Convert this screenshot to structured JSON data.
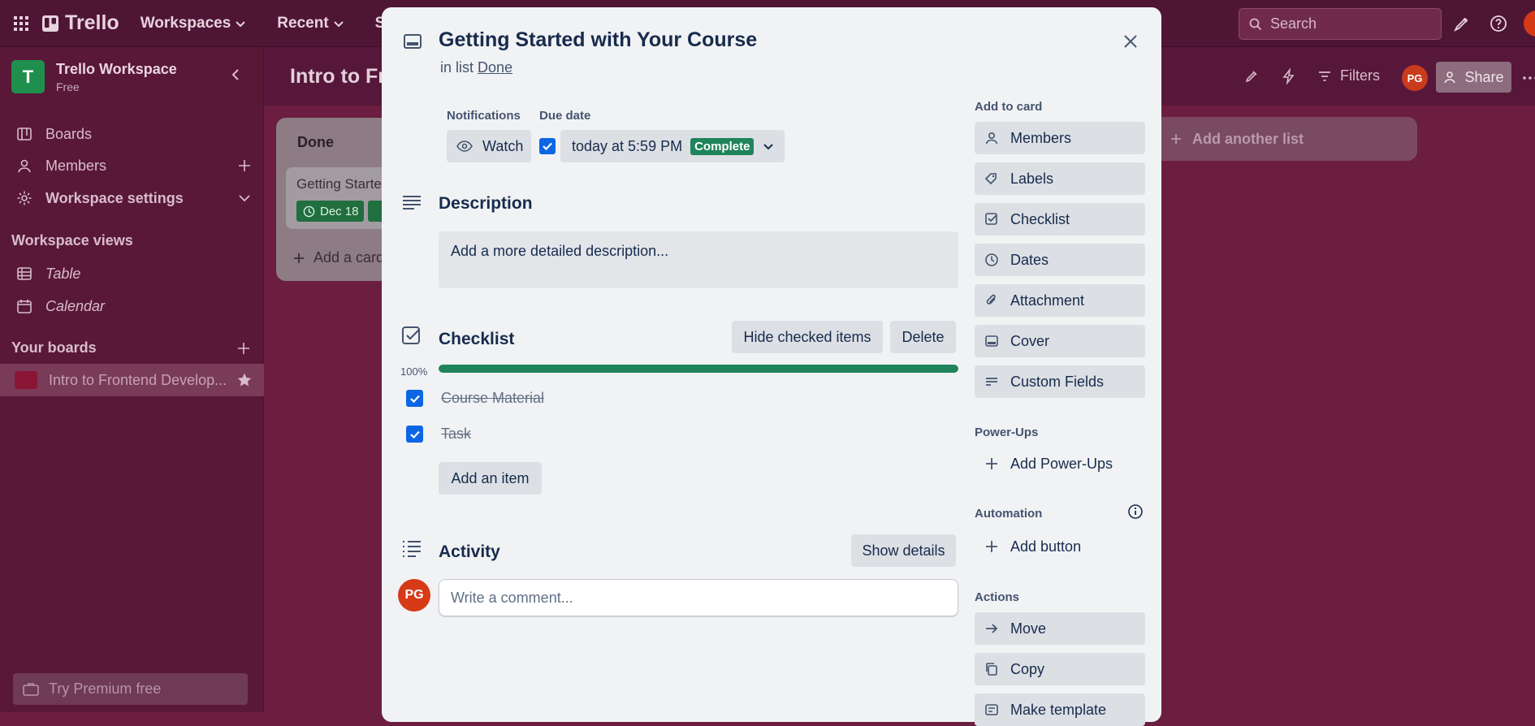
{
  "topbar": {
    "brand": "Trello",
    "nav": [
      "Workspaces",
      "Recent",
      "St"
    ],
    "search_placeholder": "Search"
  },
  "sidebar": {
    "workspace_initial": "T",
    "workspace_name": "Trello Workspace",
    "workspace_plan": "Free",
    "items": [
      {
        "label": "Boards",
        "icon": "board-icon"
      },
      {
        "label": "Members",
        "icon": "person-icon"
      },
      {
        "label": "Workspace settings",
        "icon": "gear-icon"
      }
    ],
    "views_title": "Workspace views",
    "views": [
      {
        "label": "Table",
        "icon": "table-icon"
      },
      {
        "label": "Calendar",
        "icon": "calendar-icon"
      }
    ],
    "boards_title": "Your boards",
    "board_name": "Intro to Frontend Develop...",
    "premium": "Try Premium free"
  },
  "board": {
    "title": "Intro to Fro",
    "filters_label": "Filters",
    "avatar_initials": "PG",
    "share_label": "Share",
    "list_title": "Done",
    "card_title": "Getting Starte",
    "card_due": "Dec 18",
    "add_card": "Add a card",
    "add_list": "Add another list"
  },
  "modal": {
    "title": "Getting Started with Your Course",
    "in_list_prefix": "in list",
    "list_name": "Done",
    "notifications_label": "Notifications",
    "watch_label": "Watch",
    "due_label": "Due date",
    "due_value": "today at 5:59 PM",
    "due_status": "Complete",
    "description_title": "Description",
    "description_placeholder": "Add a more detailed description...",
    "checklist_title": "Checklist",
    "hide_checked": "Hide checked items",
    "delete": "Delete",
    "progress_label": "100%",
    "progress": 1.0,
    "items": [
      "Course Material",
      "Task"
    ],
    "add_item": "Add an item",
    "activity_title": "Activity",
    "show_details": "Show details",
    "commenter_initials": "PG",
    "comment_placeholder": "Write a comment...",
    "add_to_card_title": "Add to card",
    "add_to_card": [
      "Members",
      "Labels",
      "Checklist",
      "Dates",
      "Attachment",
      "Cover",
      "Custom Fields"
    ],
    "powerups_title": "Power-Ups",
    "add_powerups": "Add Power-Ups",
    "automation_title": "Automation",
    "add_button": "Add button",
    "actions_title": "Actions",
    "actions": [
      "Move",
      "Copy",
      "Make template"
    ]
  },
  "colors": {
    "accent_blue": "#0c66e4",
    "success_green": "#1f845a",
    "avatar_red": "#d63a16"
  }
}
